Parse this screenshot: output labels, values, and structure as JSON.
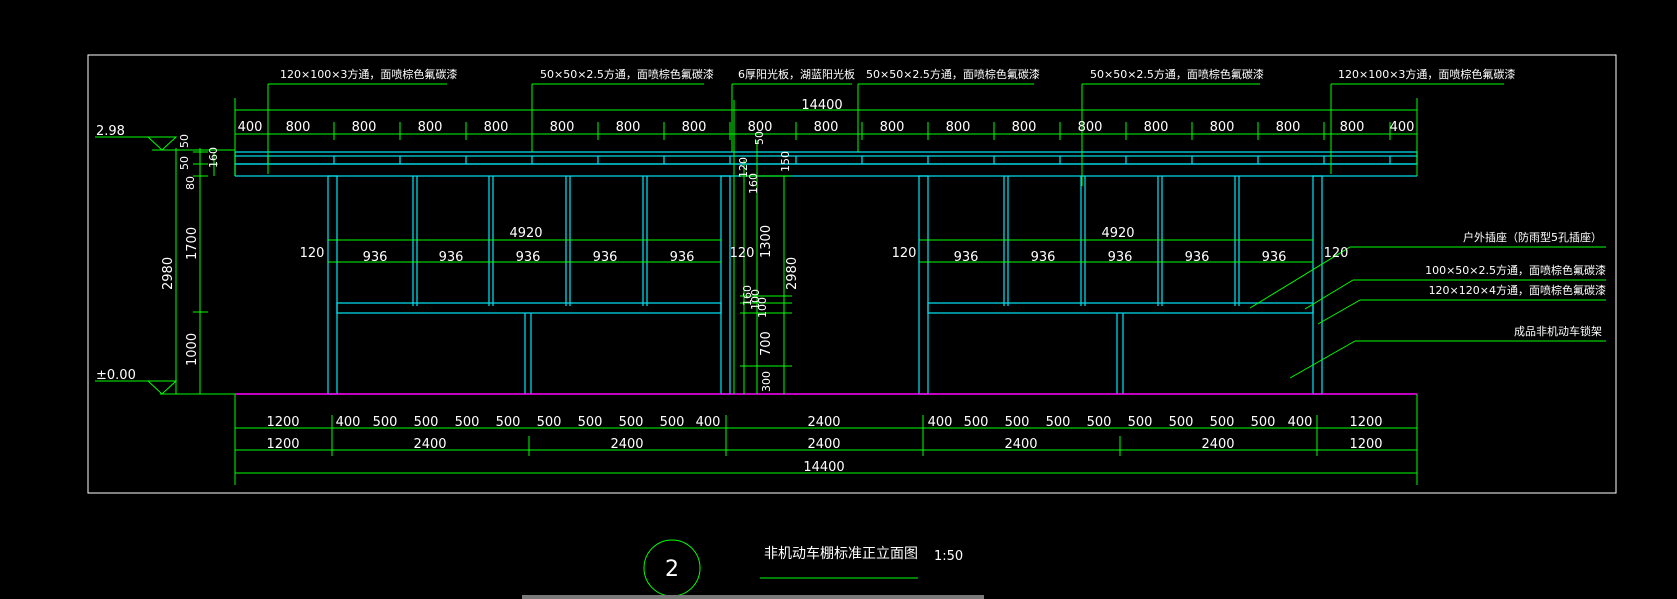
{
  "drawing": {
    "callouts": {
      "top_left": "120×100×3方通，面喷棕色氟碳漆",
      "top_mid_left": "50×50×2.5方通，面喷棕色氟碳漆",
      "top_center": "6厚阳光板，湖蓝阳光板",
      "top_mid_right": "50×50×2.5方通，面喷棕色氟碳漆",
      "top_right_a": "50×50×2.5方通，面喷棕色氟碳漆",
      "top_right_b": "120×100×3方通，面喷棕色氟碳漆",
      "right_1": "户外插座（防雨型5孔插座）",
      "right_2": "100×50×2.5方通，面喷棕色氟碳漆",
      "right_3": "120×120×4方通，面喷棕色氟碳漆",
      "right_4": "成品非机动车锁架"
    },
    "top_total": "14400",
    "top_row": [
      "400",
      "800",
      "800",
      "800",
      "800",
      "800",
      "800",
      "800",
      "800",
      "800",
      "800",
      "800",
      "800",
      "800",
      "800",
      "800",
      "800",
      "800",
      "400"
    ],
    "top_small_50": "50",
    "left_levels": {
      "top": "2.98",
      "bottom": "±0.00"
    },
    "left_dims": [
      "50",
      "50",
      "80",
      "160",
      "1700",
      "2980",
      "1000"
    ],
    "mid_dims": [
      "120",
      "160",
      "150",
      "1300",
      "2980",
      "160",
      "100",
      "100",
      "700",
      "300"
    ],
    "bay_width": "4920",
    "bay_row": [
      "120",
      "936",
      "936",
      "936",
      "936",
      "936",
      "120"
    ],
    "bottom_row1": [
      "1200",
      "400",
      "500",
      "500",
      "500",
      "500",
      "500",
      "500",
      "500",
      "500",
      "400",
      "2400",
      "400",
      "500",
      "500",
      "500",
      "500",
      "500",
      "500",
      "500",
      "500",
      "400",
      "1200"
    ],
    "bottom_row2": [
      "1200",
      "2400",
      "2400",
      "2400",
      "2400",
      "2400",
      "1200"
    ],
    "bottom_total": "14400"
  },
  "title_block": {
    "number": "2",
    "title": "非机动车棚标准正立面图",
    "scale": "1:50"
  },
  "colors": {
    "background": "#000000",
    "frame": "#ffffff",
    "structure": "#00d8e8",
    "dimension": "#00ff00",
    "ground": "#ff00ff",
    "text": "#ffffff"
  }
}
